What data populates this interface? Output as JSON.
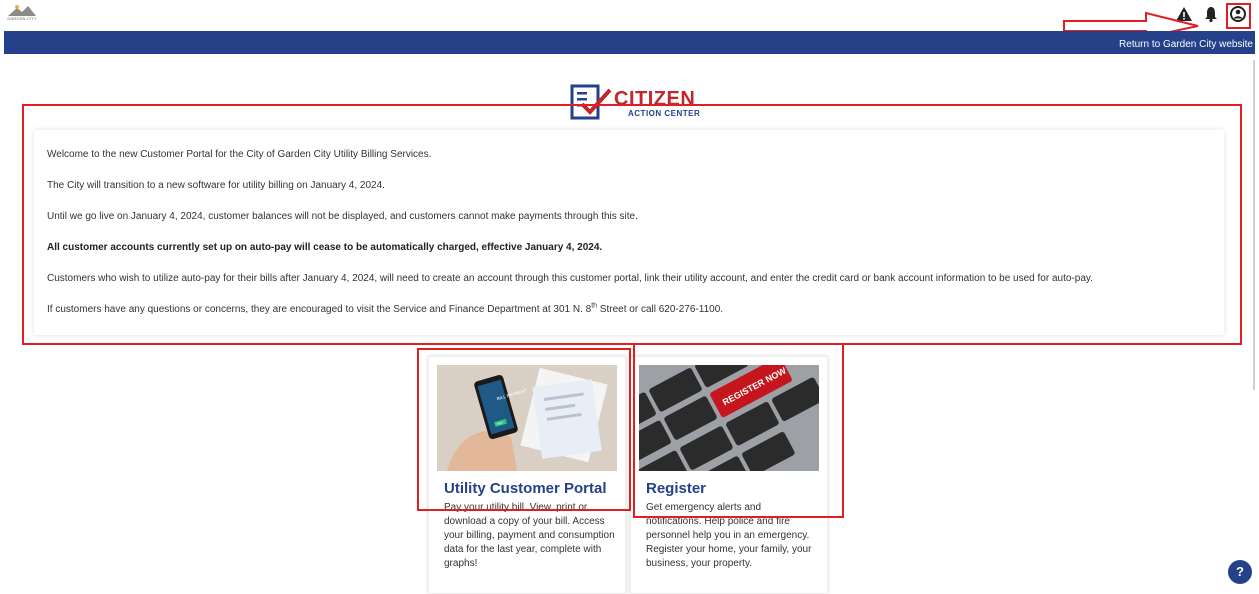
{
  "header": {
    "logo_text": "GARDEN CITY",
    "icons": [
      "alert-icon",
      "bell-icon",
      "user-icon"
    ],
    "return_link": "Return to Garden City website"
  },
  "brand": {
    "title": "CITIZEN",
    "subtitle": "ACTION CENTER"
  },
  "notice": {
    "line1": "Welcome to the new Customer Portal for the City of Garden City Utility Billing Services.",
    "line2": "The City will transition to a new software for utility billing on January 4, 2024.",
    "line3": "Until we go live on January 4, 2024, customer balances will not be displayed, and customers cannot make payments through this site.",
    "line4": "All customer accounts currently set up on auto-pay will cease to be automatically charged, effective January 4, 2024.",
    "line5": "Customers who wish to utilize auto-pay for their bills after January 4, 2024, will need to create an account through this customer portal, link their utility account, and enter the credit card or bank account information to be used for auto-pay.",
    "line6_a": "If customers have any questions or concerns, they are encouraged to visit the Service and Finance Department at 301 N. 8",
    "line6_sup": "th",
    "line6_b": " Street or call 620-276-1100."
  },
  "cards": [
    {
      "title": "Utility Customer Portal",
      "description": "Pay your utility bill. View, print or download a copy of your bill. Access your billing, payment and consumption data for the last year, complete with graphs!",
      "image_phone_text": "BILL PAYMENT",
      "image_pay": "PAY"
    },
    {
      "title": "Register",
      "description": "Get emergency alerts and notifications. Help police and fire personnel help you in an emergency. Register your home, your family, your business, your property.",
      "image_key_text": "REGISTER NOW"
    }
  ],
  "help_label": "?",
  "colors": {
    "nav": "#24418a",
    "brand_red": "#c1272d",
    "annotation_red": "#e02020"
  }
}
